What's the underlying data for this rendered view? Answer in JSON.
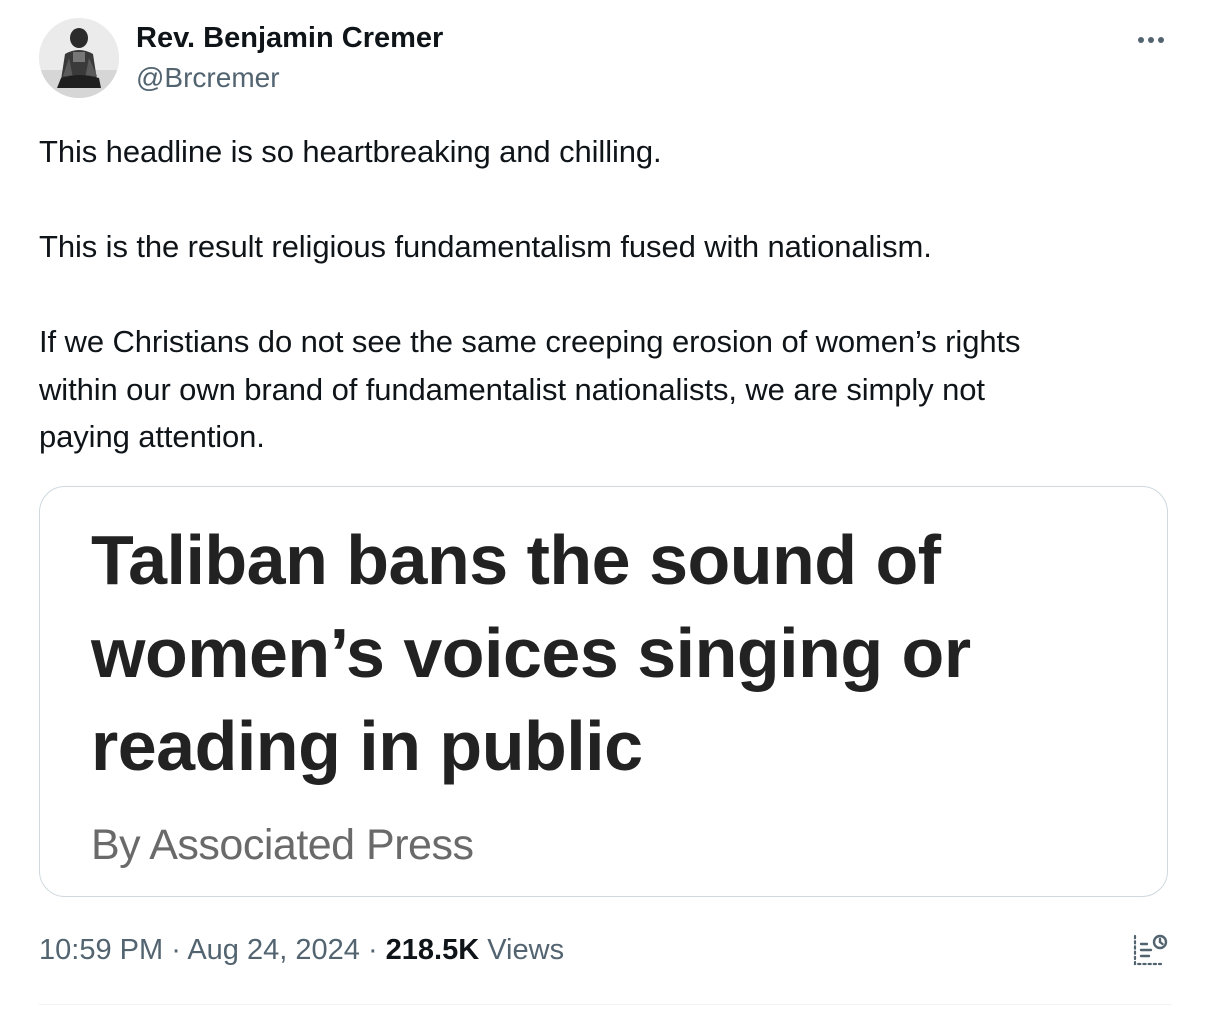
{
  "author": {
    "display_name": "Rev. Benjamin Cremer",
    "handle": "@Brcremer",
    "avatar_icon": "profile-photo"
  },
  "menu_icon": "more-horizontal-icon",
  "tweet": {
    "paragraphs": [
      [
        "This headline is so heartbreaking and chilling."
      ],
      [
        "This is the result religious fundamentalism fused with nationalism."
      ],
      [
        "If we Christians do not see the same creeping erosion of women’s rights",
        "within our own brand of fundamentalist nationalists, we are simply not",
        "paying attention."
      ]
    ]
  },
  "media": {
    "headline_lines": [
      "Taliban bans the sound of",
      "women’s voices singing or",
      "reading in public"
    ],
    "byline": "By Associated Press"
  },
  "meta": {
    "time": "10:59 PM",
    "separator": "·",
    "date": "Aug 24, 2024",
    "views_count": "218.5K",
    "views_label": "Views",
    "analytics_icon": "analytics-icon"
  },
  "colors": {
    "text_primary": "#0f1419",
    "text_secondary": "#536471",
    "border": "#cfd9de",
    "headline": "#222222",
    "byline": "#6a6a6a"
  }
}
